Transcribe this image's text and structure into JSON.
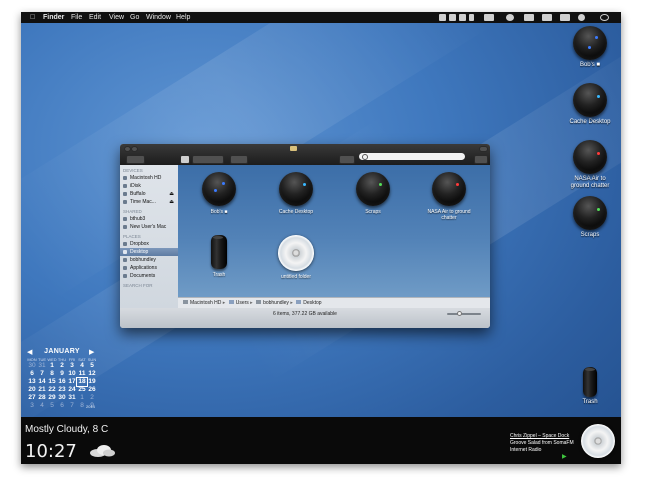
{
  "menubar": {
    "apple": "",
    "items": [
      "Finder",
      "File",
      "Edit",
      "View",
      "Go",
      "Window",
      "Help"
    ]
  },
  "desktop_icons": [
    {
      "label": "Bob's ■",
      "dot_color": "#3b7bff"
    },
    {
      "label": "Cache Desktop",
      "dot_color": "#39b8ff"
    },
    {
      "label": "NASA Air to ground chatter",
      "dot_color": "#ff3a3a"
    },
    {
      "label": "Scraps",
      "dot_color": "#54e058"
    },
    {
      "label": "Trash"
    }
  ],
  "finder": {
    "sidebar": {
      "devices_header": "DEVICES",
      "devices": [
        "Macintosh HD",
        "iDisk",
        "Buffalo",
        "Time Mac..."
      ],
      "shared_header": "SHARED",
      "shared": [
        "bthub3",
        "New User's Mac"
      ],
      "places_header": "PLACES",
      "places": [
        "Dropbox",
        "Desktop",
        "bobhundley",
        "Applications",
        "Documents"
      ],
      "search_header": "SEARCH FOR"
    },
    "items": [
      {
        "label": "Bob's ■",
        "kind": "orb",
        "dot_color": "#3b7bff"
      },
      {
        "label": "Cache Desktop",
        "kind": "orb",
        "dot_color": "#39b8ff"
      },
      {
        "label": "Scraps",
        "kind": "orb",
        "dot_color": "#54e058"
      },
      {
        "label": "NASA Air to ground chatter",
        "kind": "orb",
        "dot_color": "#ff3a3a"
      },
      {
        "label": "Trash",
        "kind": "can"
      },
      {
        "label": "untitled folder",
        "kind": "cd"
      }
    ],
    "path": [
      "Macintosh HD",
      "Users",
      "bobhundley",
      "Desktop"
    ],
    "status": "6 items, 377.22 GB available",
    "selected_sidebar": "Desktop"
  },
  "calendar": {
    "month": "JANUARY",
    "prev": "◀",
    "next": "▶",
    "weekdays": [
      "MON",
      "TUE",
      "WED",
      "THU",
      "FRI",
      "SAT",
      "SUN"
    ],
    "weeks": [
      [
        "30",
        "31",
        "1",
        "2",
        "3",
        "4",
        "5"
      ],
      [
        "6",
        "7",
        "8",
        "9",
        "10",
        "11",
        "12"
      ],
      [
        "13",
        "14",
        "15",
        "16",
        "17",
        "18",
        "19"
      ],
      [
        "20",
        "21",
        "22",
        "23",
        "24",
        "25",
        "26"
      ],
      [
        "27",
        "28",
        "29",
        "30",
        "31",
        "1",
        "2"
      ],
      [
        "3",
        "4",
        "5",
        "6",
        "7",
        "8",
        "9"
      ]
    ],
    "today": "18",
    "year": "2014"
  },
  "widgets": {
    "weather": "Mostly Cloudy, 8 C",
    "time": "10:27",
    "song": "Chris Zippel – Space Dock",
    "album": "Groove Salad from SomaFM",
    "source": "Internet Radio",
    "play": "▶"
  }
}
